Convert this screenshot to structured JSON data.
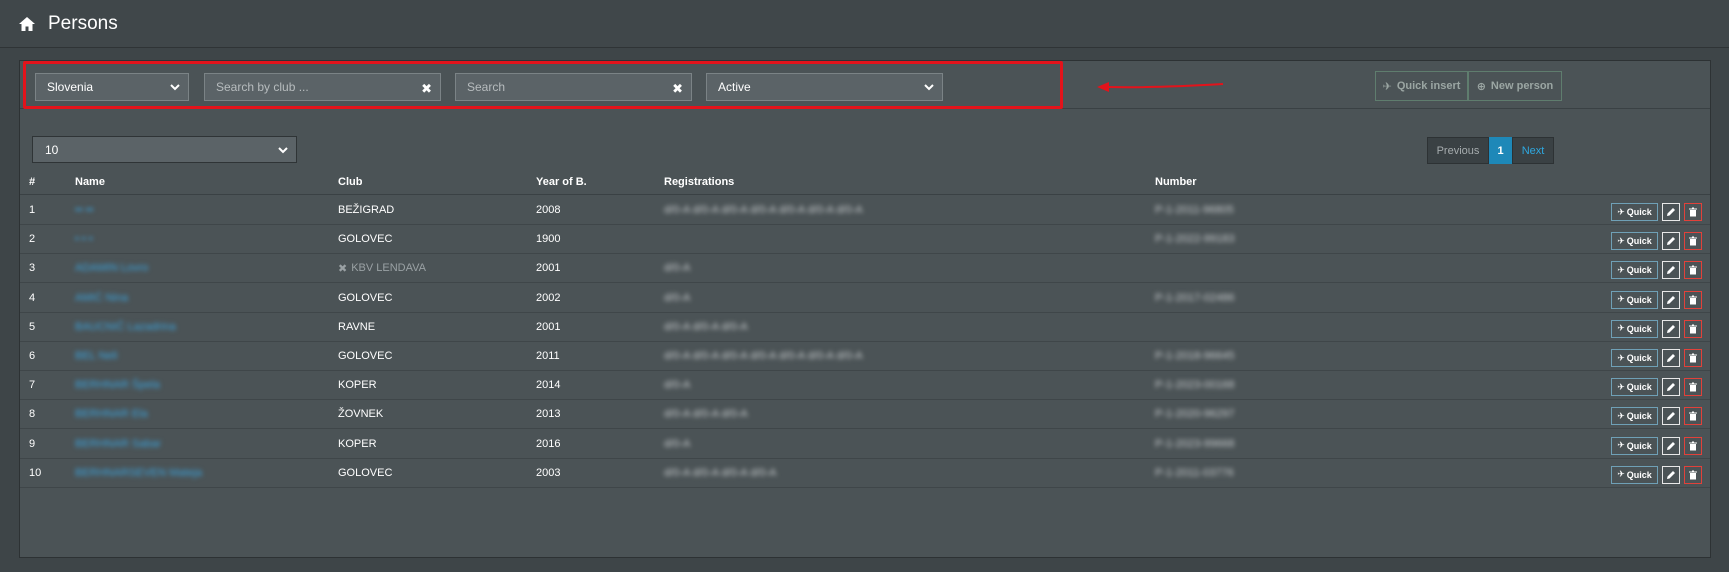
{
  "header": {
    "title": "Persons",
    "icon": "home-icon"
  },
  "filters": {
    "country": "Slovenia",
    "club_placeholder": "Search by club ...",
    "search_placeholder": "Search",
    "status": "Active"
  },
  "toolbar": {
    "quick_insert_label": "Quick insert",
    "new_person_label": "New person"
  },
  "page_size": "10",
  "pagination": {
    "previous": "Previous",
    "current": "1",
    "next": "Next"
  },
  "table": {
    "headers": [
      "#",
      "Name",
      "Club",
      "Year of B.",
      "Registrations",
      "Number"
    ],
    "rows": [
      {
        "idx": "1",
        "name": "•• ••",
        "club": "BEŽIGRAD",
        "club_active": true,
        "year": "2008",
        "reg": "d/0-A d/0-A d/0-A d/0-A d/0-A d/0-A d/0-A",
        "num": "P-1-2011-96805"
      },
      {
        "idx": "2",
        "name": "• • •",
        "club": "GOLOVEC",
        "club_active": true,
        "year": "1900",
        "reg": "",
        "num": "P-1-2022-99183"
      },
      {
        "idx": "3",
        "name": "ADAMIN Lovro",
        "club": "KBV LENDAVA",
        "club_active": false,
        "year": "2001",
        "reg": "d/0-A",
        "num": ""
      },
      {
        "idx": "4",
        "name": "AMIĆ Nina",
        "club": "GOLOVEC",
        "club_active": true,
        "year": "2002",
        "reg": "d/0-A",
        "num": "P-1-2017-02486"
      },
      {
        "idx": "5",
        "name": "BAUCNIČ Lazadrina",
        "club": "RAVNE",
        "club_active": true,
        "year": "2001",
        "reg": "d/0-A d/0-A d/0-A",
        "num": ""
      },
      {
        "idx": "6",
        "name": "BEL Neli",
        "club": "GOLOVEC",
        "club_active": true,
        "year": "2011",
        "reg": "d/0-A d/0-A d/0-A d/0-A d/0-A d/0-A d/0-A",
        "num": "P-1-2018-96645"
      },
      {
        "idx": "7",
        "name": "BERHNAR Špela",
        "club": "KOPER",
        "club_active": true,
        "year": "2014",
        "reg": "d/0-A",
        "num": "P-1-2023-00168"
      },
      {
        "idx": "8",
        "name": "BERHNAR Ela",
        "club": "ŽOVNEK",
        "club_active": true,
        "year": "2013",
        "reg": "d/0-A d/0-A d/0-A",
        "num": "P-1-2020-96297"
      },
      {
        "idx": "9",
        "name": "BERHNAR Sabar",
        "club": "KOPER",
        "club_active": true,
        "year": "2016",
        "reg": "d/0-A",
        "num": "P-1-2023-99668"
      },
      {
        "idx": "10",
        "name": "BERHNARSEVEN Mateja",
        "club": "GOLOVEC",
        "club_active": true,
        "year": "2003",
        "reg": "d/0-A d/0-A d/0-A d/0-A",
        "num": "P-1-2011-03776"
      }
    ],
    "row_actions": {
      "quick_label": "Quick"
    }
  },
  "colors": {
    "accent": "#1e88b8",
    "link": "#3ba3dc",
    "danger": "#e2413a",
    "highlight": "#e3131b"
  }
}
